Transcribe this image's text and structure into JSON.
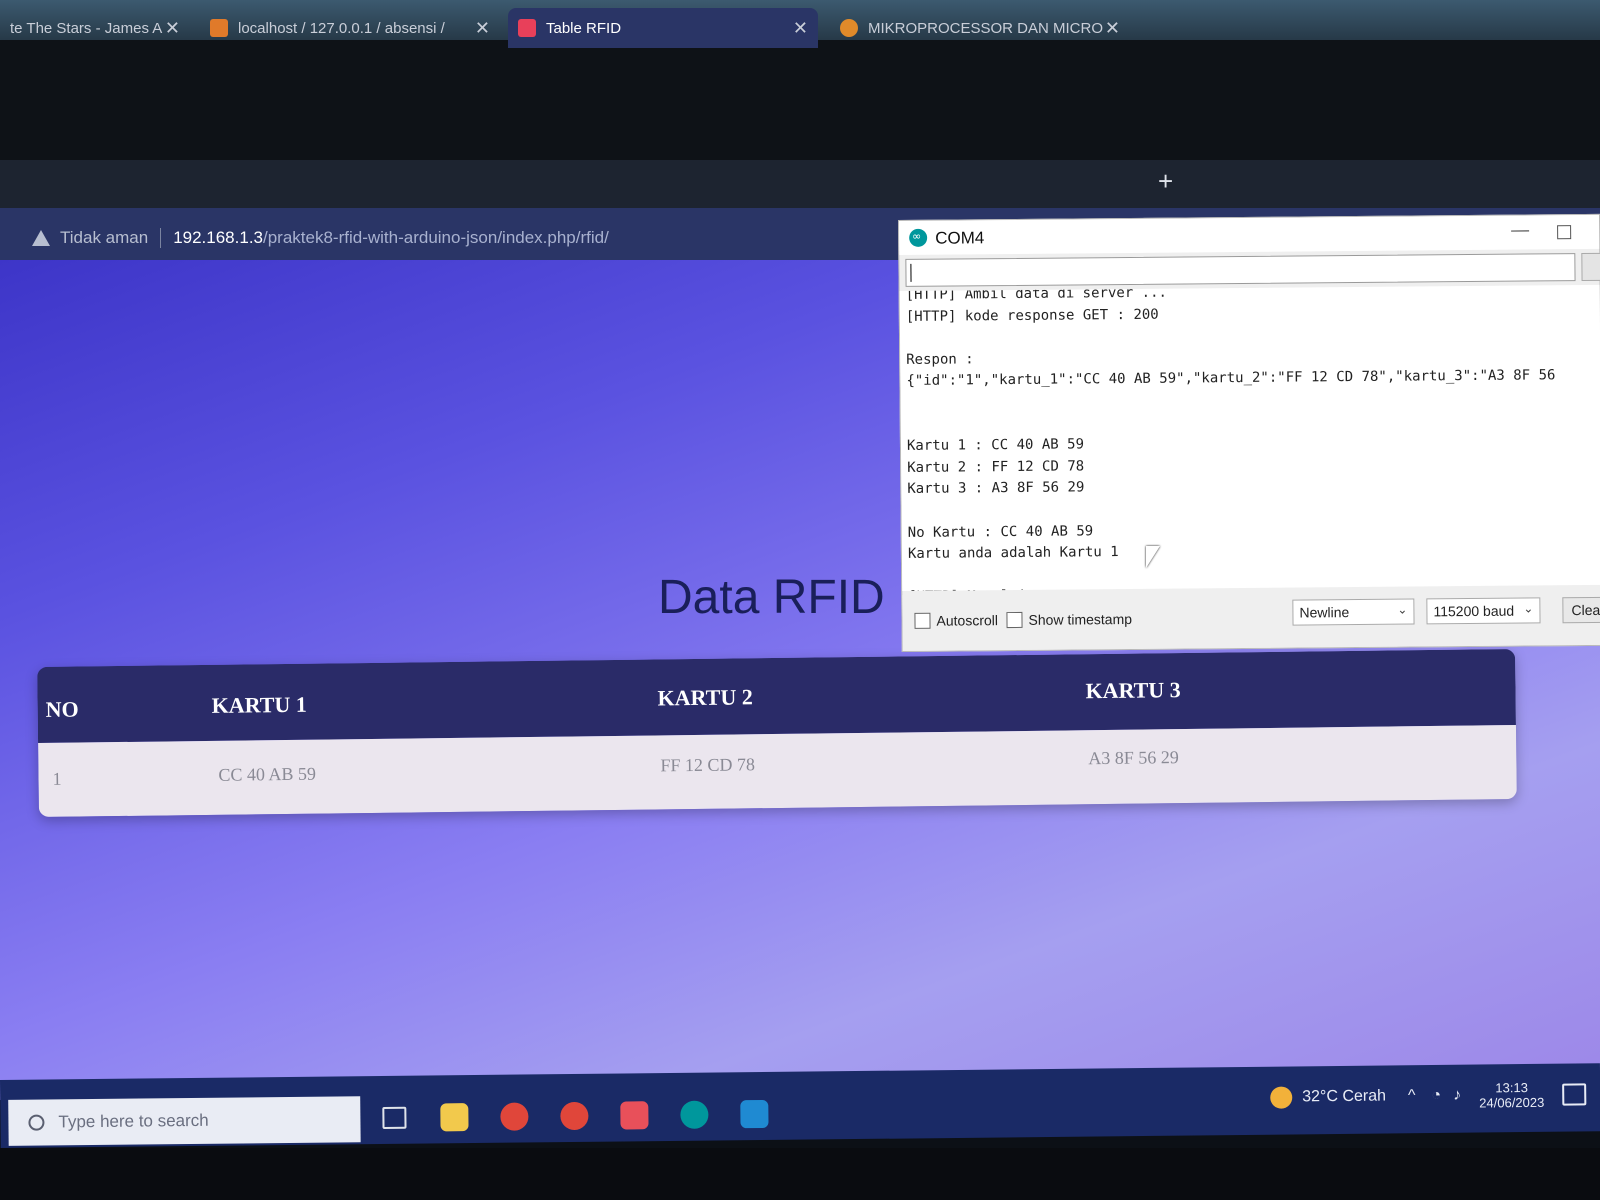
{
  "browser": {
    "tabs": [
      {
        "label": "te The Stars - James A",
        "active": false
      },
      {
        "label": "localhost / 127.0.0.1 / absensi /",
        "active": false
      },
      {
        "label": "Table RFID",
        "active": true
      },
      {
        "label": "MIKROPROCESSOR DAN MICRO",
        "active": false
      }
    ],
    "new_tab_label": "+",
    "security_label": "Tidak aman",
    "url_host": "192.168.1.3",
    "url_path": "/praktek8-rfid-with-arduino-json/index.php/rfid/"
  },
  "page": {
    "title": "Data RFID",
    "table": {
      "headers": [
        "NO",
        "KARTU 1",
        "KARTU 2",
        "KARTU 3"
      ],
      "rows": [
        [
          "1",
          "CC 40 AB 59",
          "FF 12 CD 78",
          "A3 8F 56 29"
        ]
      ]
    }
  },
  "serial_monitor": {
    "title": "COM4",
    "output": "[HTTP] Ambil data di server ...\n[HTTP] kode response GET : 200\n\nRespon :\n{\"id\":\"1\",\"kartu_1\":\"CC 40 AB 59\",\"kartu_2\":\"FF 12 CD 78\",\"kartu_3\":\"A3 8F 56\n\n\nKartu 1 : CC 40 AB 59\nKartu 2 : FF 12 CD 78\nKartu 3 : A3 8F 56 29\n\nNo Kartu : CC 40 AB 59\nKartu anda adalah Kartu 1\n\n[HTTP] Memulai...",
    "autoscroll_label": "Autoscroll",
    "timestamp_label": "Show timestamp",
    "line_ending": "Newline",
    "baud": "115200 baud",
    "clear_label": "Clear"
  },
  "taskbar": {
    "search_placeholder": "Type here to search",
    "weather": "32°C  Cerah",
    "time": "13:13",
    "date": "24/06/2023",
    "apps": [
      "task-view",
      "file-explorer",
      "chrome",
      "chrome",
      "xampp",
      "arduino",
      "vscode"
    ]
  },
  "colors": {
    "tab_active": "#2a3566",
    "page_gradient_start": "#3d35c8",
    "page_gradient_end": "#a59ff0",
    "table_header": "#2a2b68",
    "taskbar": "#1a2a66",
    "arduino_teal": "#00979c"
  }
}
